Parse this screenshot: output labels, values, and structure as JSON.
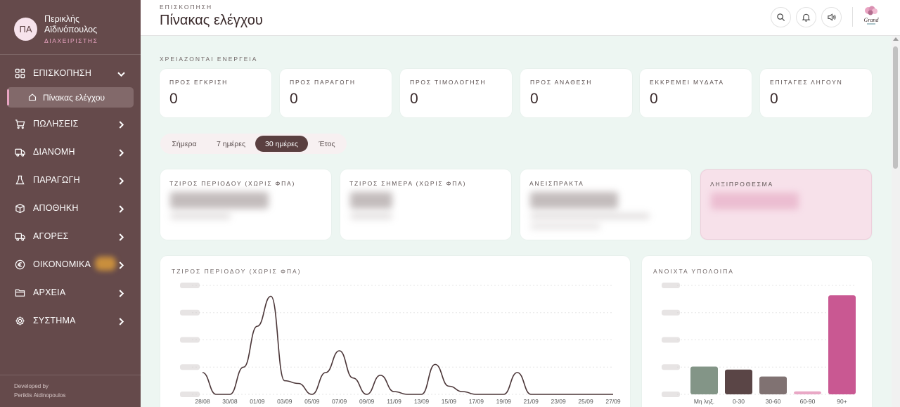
{
  "sidebar": {
    "user": {
      "initials": "ΠΑ",
      "name": "Περικλής Αϊδινόπουλος",
      "role": "ΔΙΑΧΕΙΡΙΣΤΗΣ"
    },
    "items": [
      {
        "label": "ΕΠΙΣΚΟΠΗΣΗ",
        "icon": "grid-icon",
        "expanded": true
      },
      {
        "label": "ΠΩΛΗΣΕΙΣ",
        "icon": "cart-icon"
      },
      {
        "label": "ΔΙΑΝΟΜΗ",
        "icon": "truck-icon"
      },
      {
        "label": "ΠΑΡΑΓΩΓΗ",
        "icon": "flask-icon"
      },
      {
        "label": "ΑΠΟΘΗΚΗ",
        "icon": "box-icon"
      },
      {
        "label": "ΑΓΟΡΕΣ",
        "icon": "truck-icon"
      },
      {
        "label": "ΟΙΚΟΝΟΜΙΚΑ",
        "icon": "euro-icon"
      },
      {
        "label": "ΑΡΧΕΙΑ",
        "icon": "folder-icon"
      },
      {
        "label": "ΣΥΣΤΗΜΑ",
        "icon": "gear-icon"
      }
    ],
    "sub_item": {
      "label": "Πίνακας ελέγχου",
      "icon": "home-icon"
    },
    "developer": {
      "line1": "Developed by",
      "line2": "Periklis Aidinopoulos"
    }
  },
  "header": {
    "breadcrumb": "ΕΠΙΣΚΟΠΗΣΗ",
    "title": "Πίνακας ελέγχου",
    "logo_text": "Grand"
  },
  "action": {
    "section_label": "ΧΡΕΙΑΖΟΝΤΑΙ ΕΝΕΡΓΕΙΑ",
    "cards": [
      {
        "label": "ΠΡΟΣ ΕΓΚΡΙΣΗ",
        "value": "0"
      },
      {
        "label": "ΠΡΟΣ ΠΑΡΑΓΩΓΗ",
        "value": "0"
      },
      {
        "label": "ΠΡΟΣ ΤΙΜΟΛΟΓΗΣΗ",
        "value": "0"
      },
      {
        "label": "ΠΡΟΣ ΑΝΑΘΕΣΗ",
        "value": "0"
      },
      {
        "label": "ΕΚΚΡΕΜΕΙ ΜΥΔΑΤΑ",
        "value": "0"
      },
      {
        "label": "ΕΠΙΤΑΓΕΣ ΛΗΓΟΥΝ",
        "value": "0"
      }
    ]
  },
  "period_tabs": {
    "options": [
      "Σήμερα",
      "7 ημέρες",
      "30 ημέρες",
      "Έτος"
    ],
    "selected": "30 ημέρες"
  },
  "kpis": [
    {
      "label": "ΤΖΙΡΟΣ ΠΕΡΙΟΔΟΥ (ΧΩΡΙΣ ΦΠΑ)"
    },
    {
      "label": "ΤΖΙΡΟΣ ΣΗΜΕΡΑ (ΧΩΡΙΣ ΦΠΑ)"
    },
    {
      "label": "ΑΝΕΙΣΠΡΑΚΤΑ"
    },
    {
      "label": "ΛΗΞΙΠΡΟΘΕΣΜΑ"
    }
  ],
  "colors": {
    "sidebar_bg": "#654a4b",
    "accent_pink": "#e9a4c2",
    "overdue_bg": "#f7e1ea",
    "line": "#4a3537",
    "bar_colors": [
      "#839587",
      "#5a4546",
      "#807272",
      "#e9a8c6",
      "#c95892"
    ]
  },
  "chart_data": [
    {
      "type": "line",
      "title": "ΤΖΙΡΟΣ ΠΕΡΙΟΔΟΥ (ΧΩΡΙΣ ΦΠΑ)",
      "x_ticks": [
        "28/08",
        "30/08",
        "01/09",
        "03/09",
        "05/09",
        "07/09",
        "09/09",
        "11/09",
        "13/09",
        "15/09",
        "17/09",
        "19/09",
        "21/09",
        "23/09",
        "25/09",
        "27/09"
      ],
      "x": [
        "28/08",
        "29/08",
        "30/08",
        "31/08",
        "01/09",
        "02/09",
        "03/09",
        "04/09",
        "05/09",
        "06/09",
        "07/09",
        "08/09",
        "09/09",
        "10/09",
        "11/09",
        "12/09",
        "13/09",
        "14/09",
        "15/09",
        "16/09",
        "17/09",
        "18/09",
        "19/09",
        "20/09",
        "21/09",
        "22/09",
        "23/09",
        "24/09",
        "25/09",
        "26/09",
        "27/09"
      ],
      "values": [
        8,
        0,
        0,
        10,
        25,
        36,
        5,
        4,
        0,
        8,
        16,
        6,
        0,
        7,
        1,
        0,
        0,
        11,
        3,
        1,
        0,
        0,
        0,
        8,
        0,
        0,
        0,
        0,
        0,
        0,
        0
      ],
      "ylim": [
        0,
        40
      ],
      "grid": true,
      "yticks_obscured": true
    },
    {
      "type": "bar",
      "title": "ΑΝΟΙΧΤΑ ΥΠΟΛΟΙΠΑ",
      "categories": [
        "Μη ληξ.",
        "0-30",
        "30-60",
        "60-90",
        "90+"
      ],
      "values": [
        28,
        25,
        18,
        3,
        100
      ],
      "ylim": [
        0,
        110
      ],
      "grid": true,
      "yticks_obscured": true
    }
  ]
}
